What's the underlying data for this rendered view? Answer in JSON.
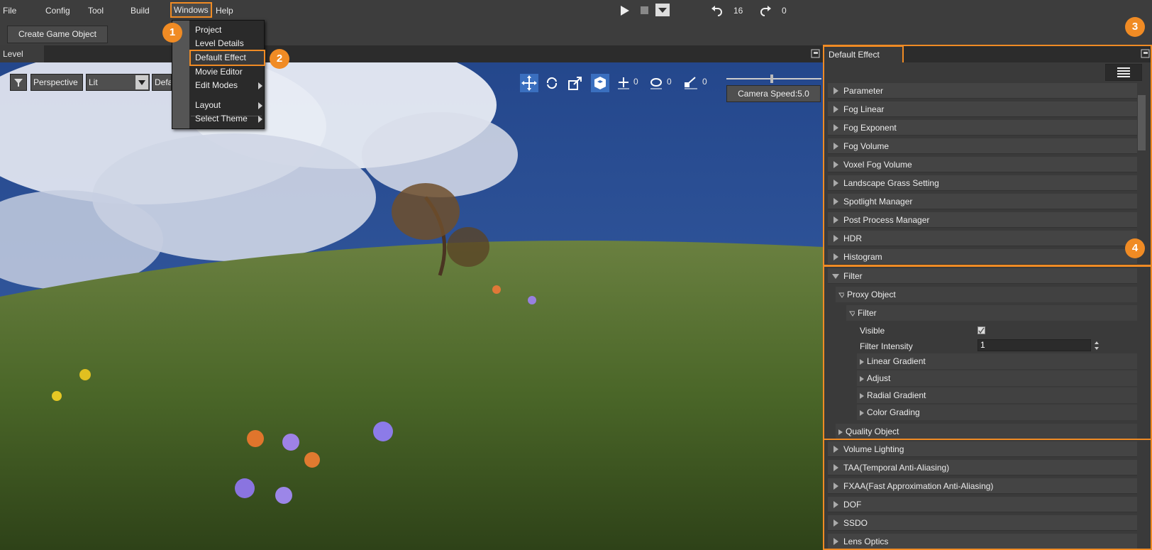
{
  "menubar": {
    "items": [
      "File",
      "Config",
      "Tool",
      "Build",
      "Windows",
      "Help"
    ],
    "undo_count": "16",
    "redo_count": "0"
  },
  "toolbar": {
    "create_label": "Create Game Object"
  },
  "level_tab": {
    "label": "Level"
  },
  "viewport": {
    "perspective": "Perspective",
    "lit": "Lit",
    "default_partial": "Defa",
    "move_count": "0",
    "rotate_count": "0",
    "scale_count": "0",
    "camera_speed": "Camera Speed:5.0"
  },
  "windows_menu": {
    "items": [
      "Project",
      "Level Details",
      "Default Effect",
      "Movie Editor",
      "Edit Modes",
      "Layout",
      "Select Theme"
    ]
  },
  "badges": [
    "1",
    "2",
    "3",
    "4"
  ],
  "panel": {
    "tab_title": "Default Effect",
    "sections": [
      "Parameter",
      "Fog Linear",
      "Fog Exponent",
      "Fog Volume",
      "Voxel Fog Volume",
      "Landscape Grass Setting",
      "Spotlight Manager",
      "Post Process Manager",
      "HDR",
      "Histogram"
    ],
    "filter": {
      "title": "Filter",
      "proxy_object": "Proxy Object",
      "inner_filter": "Filter",
      "visible_label": "Visible",
      "intensity_label": "Filter Intensity",
      "intensity_value": "1",
      "children": [
        "Linear Gradient",
        "Adjust",
        "Radial Gradient",
        "Color Grading"
      ],
      "quality_object": "Quality Object"
    },
    "sections_after": [
      "Volume Lighting",
      "TAA(Temporal Anti-Aliasing)",
      "FXAA(Fast Approximation Anti-Aliasing)",
      "DOF",
      "SSDO",
      "Lens Optics"
    ]
  },
  "colors": {
    "accent": "#f08b24",
    "sky": "#2a4b8a",
    "grass": "#4e6b2c"
  }
}
